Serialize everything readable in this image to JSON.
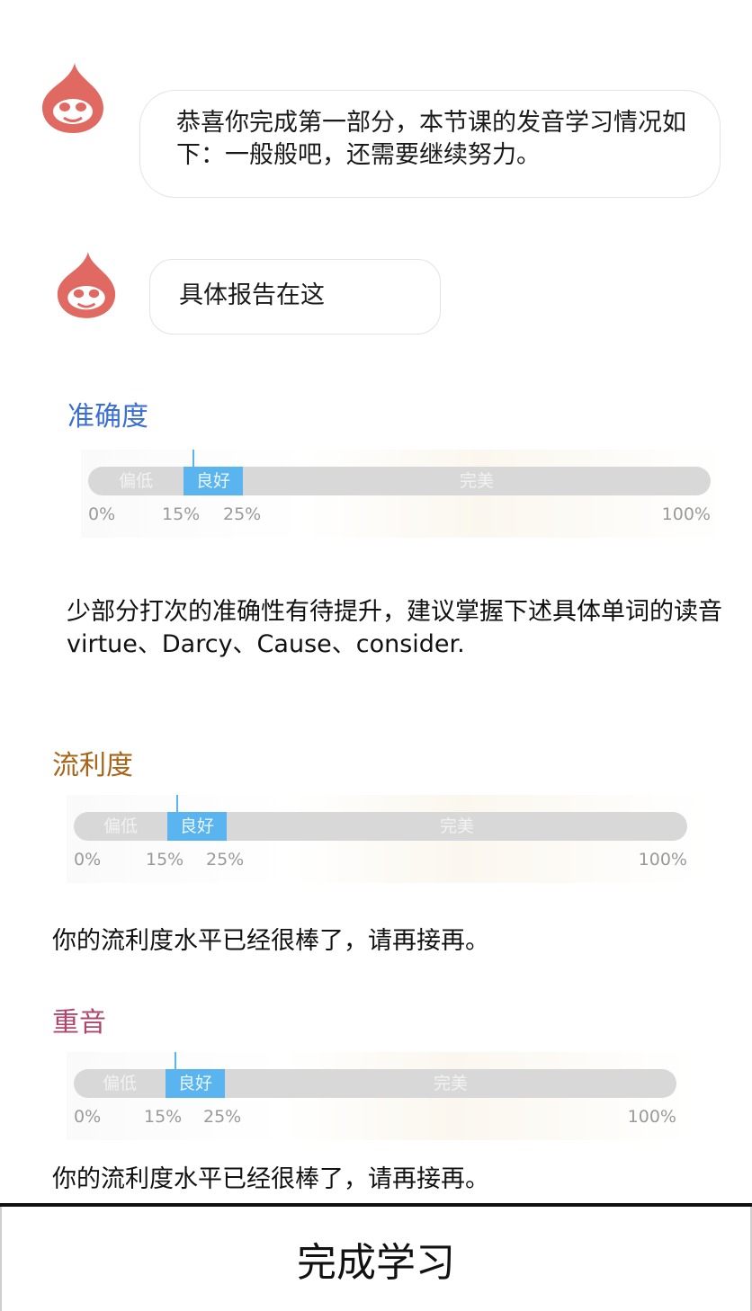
{
  "chat": {
    "messages": [
      {
        "avatar_icon": "drop-mascot-icon",
        "text": "恭喜你完成第一部分，本节课的发音学习情况如下：一般般吧，还需要继续努力。"
      },
      {
        "avatar_icon": "drop-mascot-icon",
        "text": "具体报告在这"
      }
    ]
  },
  "scale_labels": {
    "segments": [
      "偏低",
      "良好",
      "完美"
    ],
    "ticks": [
      "0%",
      "15%",
      "25%",
      "100%"
    ]
  },
  "sections": [
    {
      "title": "准确度",
      "score_percent": 18,
      "feedback": "少部分打次的准确性有待提升，建议掌握下述具体单词的读音",
      "words": "virtue、Darcy、Cause、consider."
    },
    {
      "title": "流利度",
      "score_percent": 18,
      "feedback": "你的流利度水平已经很棒了，请再接再。"
    },
    {
      "title": "重音",
      "score_percent": 18,
      "feedback": "你的流利度水平已经很棒了，请再接再。"
    }
  ],
  "footer": {
    "finish_label": "完成学习"
  },
  "colors": {
    "accent_blue": "#5ab4f0",
    "title_accuracy": "#3b6fd6",
    "title_fluency": "#a86418",
    "title_stress": "#b0476a",
    "mascot": "#e06a62"
  }
}
